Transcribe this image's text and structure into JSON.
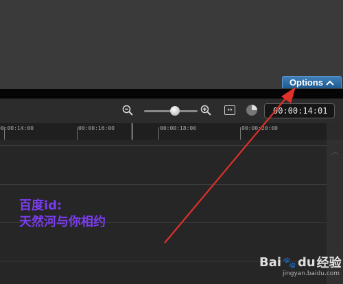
{
  "header": {
    "options_label": "Options"
  },
  "toolbar": {
    "timecode": "00:00:14:01"
  },
  "ruler": {
    "ticks": [
      "00:00:14:00",
      "00:00:16:00",
      "00:00:18:00",
      "00:00:20:00"
    ]
  },
  "overlay": {
    "line1": "百度id:",
    "line2": "天然河与你相约"
  },
  "watermark": {
    "brand_bai": "Bai",
    "brand_du": "du",
    "brand_cn": "经验",
    "url": "jingyan.baidu.com"
  },
  "colors": {
    "options_blue": "#2a6aa3",
    "overlay_purple": "#7b3cf0",
    "arrow_red": "#e0302a"
  },
  "icons": [
    "zoom-out-icon",
    "zoom-in-icon",
    "fit-icon",
    "clock-icon",
    "chevron-up-icon",
    "baidu-paw-icon"
  ]
}
